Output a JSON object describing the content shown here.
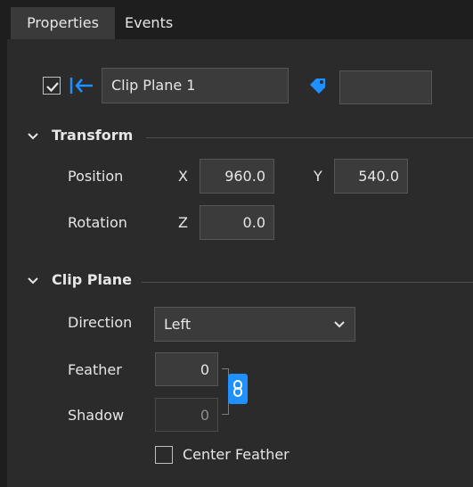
{
  "tabs": [
    {
      "label": "Properties",
      "active": true
    },
    {
      "label": "Events",
      "active": false
    }
  ],
  "header": {
    "visible_checked": true,
    "name_value": "Clip Plane 1",
    "tag_value": "",
    "icons": {
      "visibility": "checkbox-icon",
      "anchor": "arrow-left-bar-icon",
      "tag": "tag-icon"
    }
  },
  "transform": {
    "title": "Transform",
    "position_label": "Position",
    "x_label": "X",
    "x_value": "960.0",
    "y_label": "Y",
    "y_value": "540.0",
    "rotation_label": "Rotation",
    "z_label": "Z",
    "z_value": "0.0"
  },
  "clip_plane": {
    "title": "Clip Plane",
    "direction_label": "Direction",
    "direction_value": "Left",
    "feather_label": "Feather",
    "feather_value": "0",
    "shadow_label": "Shadow",
    "shadow_value": "0",
    "link_icon": "link-icon",
    "center_feather_label": "Center Feather",
    "center_feather_checked": false
  },
  "colors": {
    "accent": "#1e90ff",
    "tabbar": "#1e1e1e",
    "panel": "#2b2b2b"
  }
}
